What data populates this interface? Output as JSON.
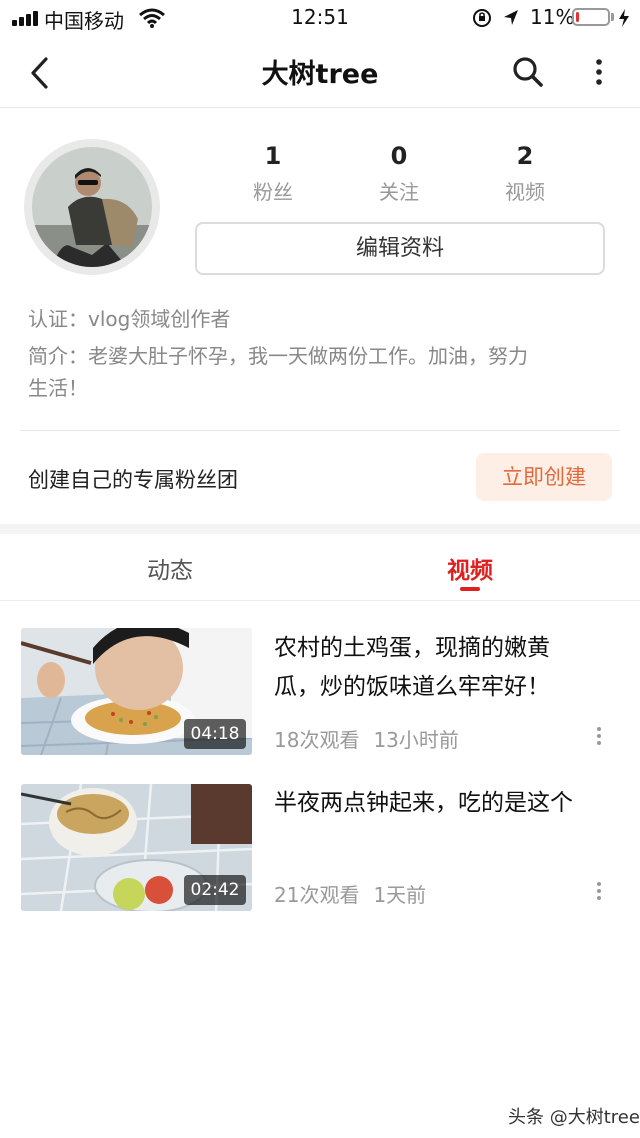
{
  "status_bar": {
    "carrier": "中国移动",
    "time": "12:51",
    "battery": "11%",
    "battery_level": 0.11,
    "icons": [
      "signal-icon",
      "wifi-icon",
      "orientation-lock-icon",
      "location-icon",
      "battery-icon",
      "charging-icon"
    ]
  },
  "nav": {
    "title": "大树tree",
    "icons": [
      "back-arrow-icon",
      "search-icon",
      "more-vertical-icon"
    ]
  },
  "profile": {
    "stats": [
      {
        "value": "1",
        "label": "粉丝"
      },
      {
        "value": "0",
        "label": "关注"
      },
      {
        "value": "2",
        "label": "视频"
      }
    ],
    "edit_label": "编辑资料",
    "certification": "认证：vlog领域创作者",
    "bio_line1": "简介：老婆大肚子怀孕，我一天做两份工作。加油，努力",
    "bio_line2": "生活！"
  },
  "fan_group": {
    "text": "创建自己的专属粉丝团",
    "button_label": "立即创建"
  },
  "tabs": [
    {
      "label": "动态",
      "active": false
    },
    {
      "label": "视频",
      "active": true
    }
  ],
  "videos": [
    {
      "title_line1": "农村的土鸡蛋，现摘的嫩黄",
      "title_line2": "瓜，炒的饭味道么牢牢好！",
      "views": "18次观看",
      "time_ago": "13小时前",
      "duration": "04:18"
    },
    {
      "title_line1": "半夜两点钟起来，吃的是这个",
      "title_line2": "",
      "views": "21次观看",
      "time_ago": "1天前",
      "duration": "02:42"
    }
  ],
  "watermark": "头条 @大树tree",
  "colors": {
    "accent_red": "#e02020",
    "create_button_bg": "#fdeee6",
    "create_button_text": "#e26a3b",
    "battery_low": "#e33333"
  }
}
